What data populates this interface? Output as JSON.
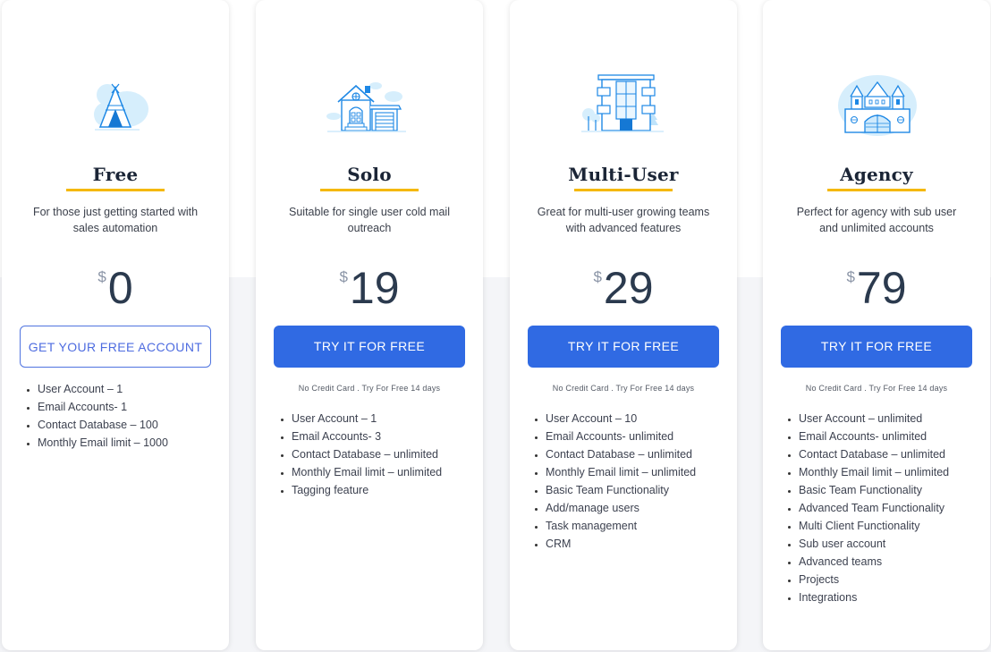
{
  "plans": [
    {
      "icon": "teepee-icon",
      "title": "Free",
      "description": "For those just getting started with sales automation",
      "currency": "$",
      "price": "0",
      "button_label": "GET YOUR FREE ACCOUNT",
      "button_style": "outline",
      "note": "",
      "features": [
        "User Account – 1",
        "Email Accounts- 1",
        "Contact Database – 100",
        "Monthly Email limit – 1000"
      ]
    },
    {
      "icon": "house-icon",
      "title": "Solo",
      "description": "Suitable for single user cold mail outreach",
      "currency": "$",
      "price": "19",
      "button_label": "TRY IT FOR FREE",
      "button_style": "solid",
      "note": "No Credit Card . Try For Free 14 days",
      "features": [
        "User Account – 1",
        "Email Accounts- 3",
        "Contact Database – unlimited",
        "Monthly Email limit – unlimited",
        "Tagging feature"
      ]
    },
    {
      "icon": "apartment-building-icon",
      "title": "Multi-User",
      "description": "Great for multi-user growing teams with advanced features",
      "currency": "$",
      "price": "29",
      "button_label": "TRY IT FOR FREE",
      "button_style": "solid",
      "note": "No Credit Card . Try For Free 14 days",
      "features": [
        "User Account – 10",
        "Email Accounts- unlimited",
        "Contact Database – unlimited",
        "Monthly Email limit – unlimited",
        "Basic Team Functionality",
        "Add/manage users",
        "Task management",
        "CRM"
      ]
    },
    {
      "icon": "castle-icon",
      "title": "Agency",
      "description": "Perfect for agency with sub user and unlimited accounts",
      "currency": "$",
      "price": "79",
      "button_label": "TRY IT FOR FREE",
      "button_style": "solid",
      "note": "No Credit Card . Try For Free 14 days",
      "features": [
        "User Account – unlimited",
        "Email Accounts- unlimited",
        "Contact Database – unlimited",
        "Monthly Email limit – unlimited",
        "Basic Team Functionality",
        "Advanced Team Functionality",
        "Multi Client Functionality",
        "Sub user account",
        "Advanced teams",
        "Projects",
        "Integrations"
      ]
    }
  ],
  "colors": {
    "accent_blue": "#306ae3",
    "underline_yellow": "#f5b800",
    "icon_blue": "#1e88e5",
    "icon_light": "#cfeafc"
  }
}
